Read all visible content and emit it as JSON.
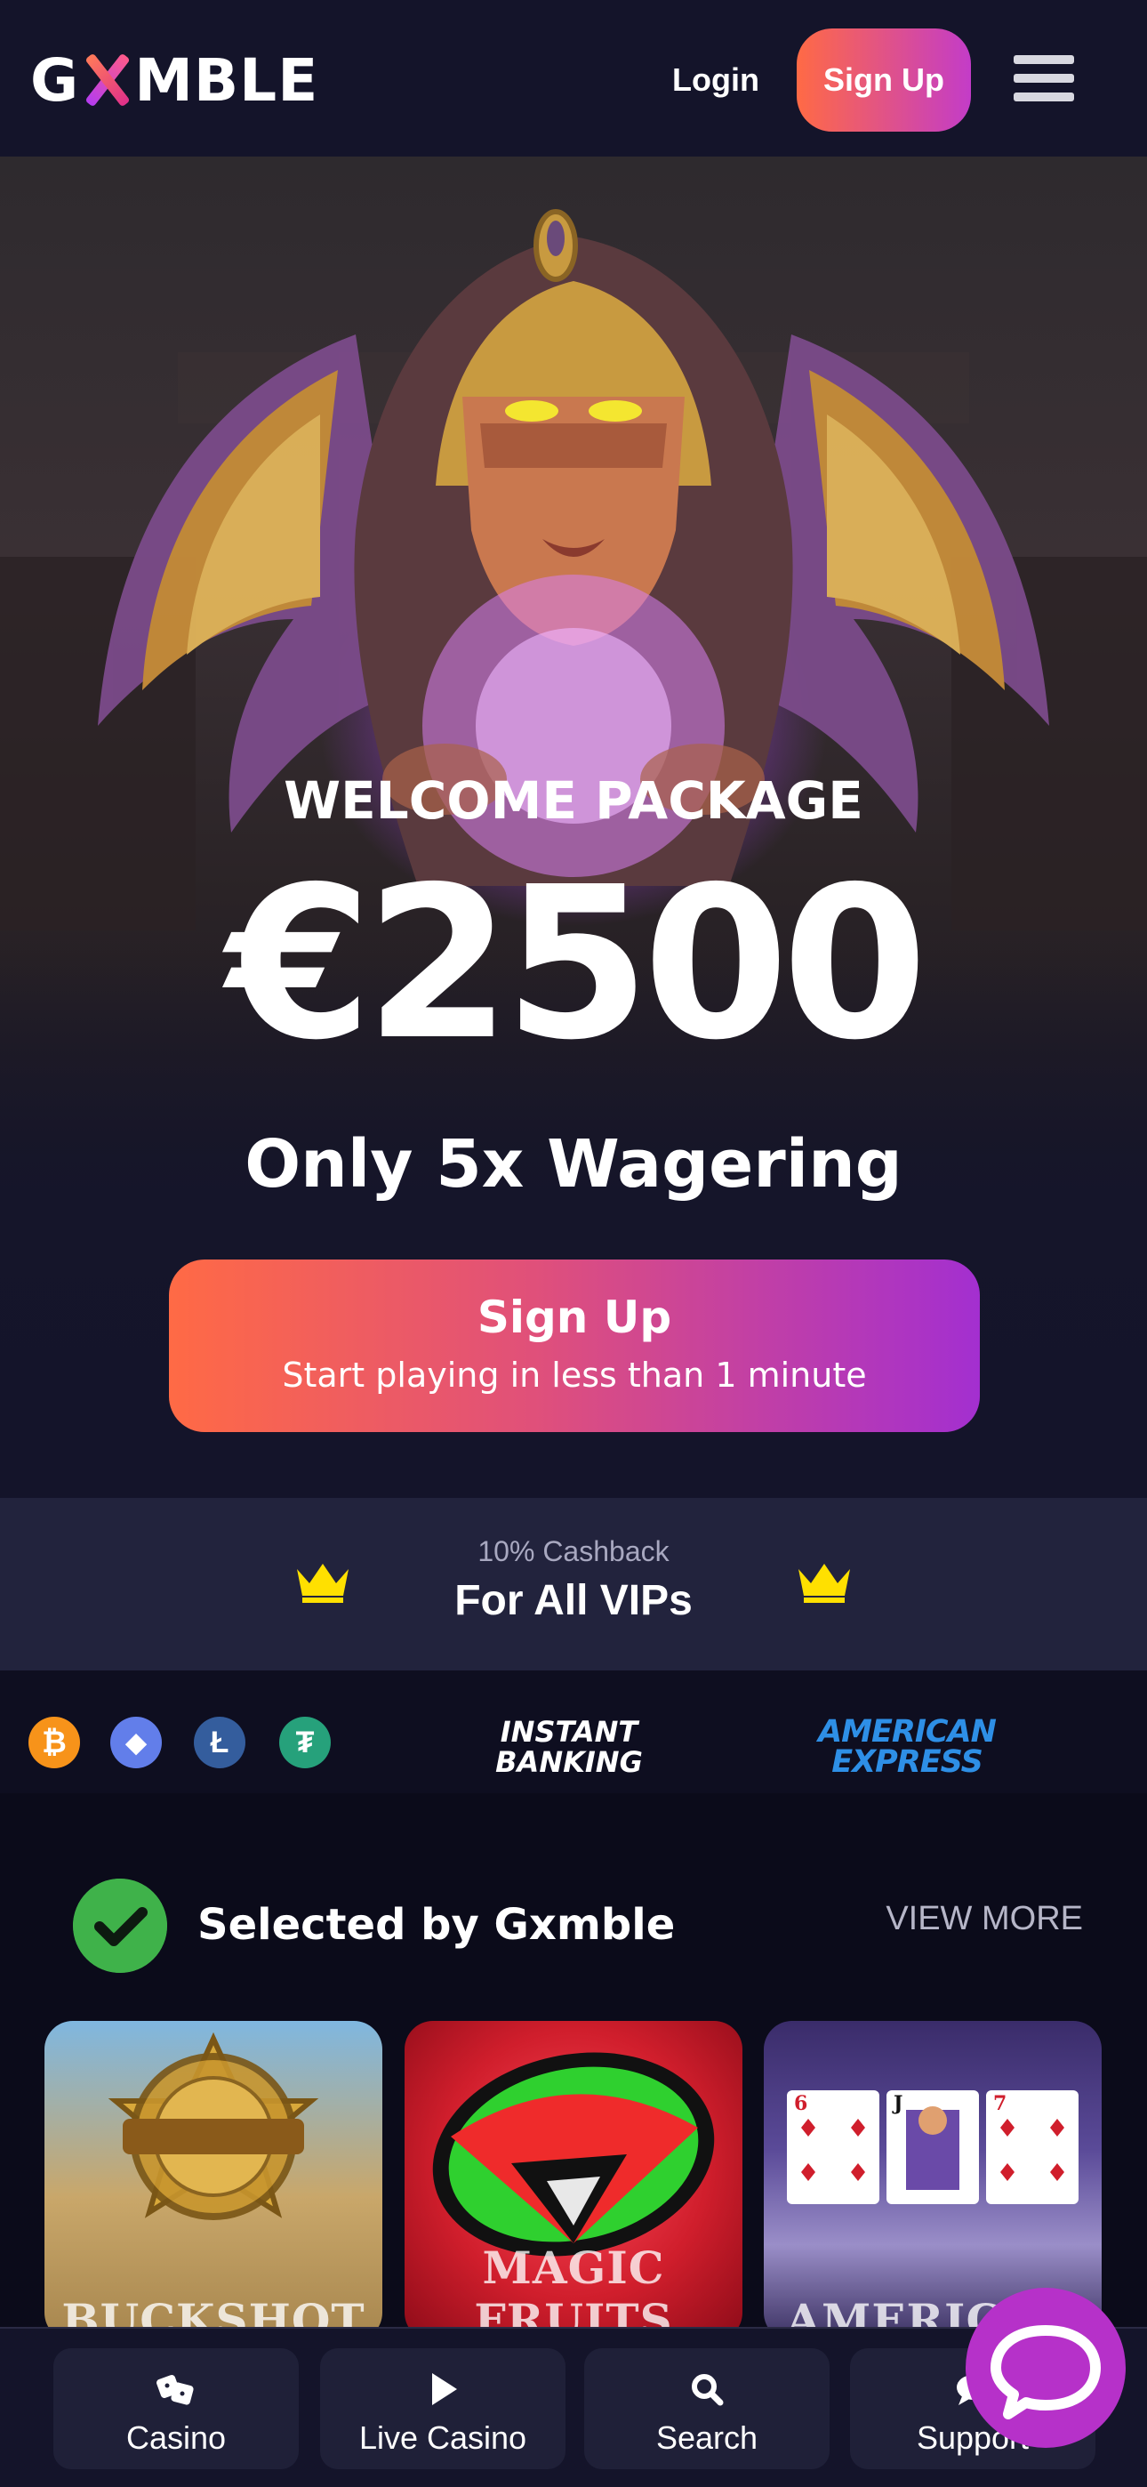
{
  "header": {
    "logo_text_left": "G",
    "logo_text_right": "MBLE",
    "login_label": "Login",
    "signup_label": "Sign Up"
  },
  "hero": {
    "welcome_title": "WELCOME PACKAGE",
    "amount": "€2500",
    "wagering": "Only 5x Wagering",
    "cta_title": "Sign Up",
    "cta_subtitle": "Start playing in less than 1 minute"
  },
  "vip": {
    "small": "10% Cashback",
    "big": "For All VIPs"
  },
  "payments": {
    "coins": [
      {
        "icon": "bitcoin-icon",
        "glyph": "₿",
        "color": "#f7931a"
      },
      {
        "icon": "ethereum-icon",
        "glyph": "◆",
        "color": "#627eea"
      },
      {
        "icon": "litecoin-icon",
        "glyph": "Ł",
        "color": "#345d9d"
      },
      {
        "icon": "tether-icon",
        "glyph": "₮",
        "color": "#26a17b"
      }
    ],
    "instant_line1": "INSTANT",
    "instant_line2": "BANKING",
    "amex_line1": "AMERICAN",
    "amex_line2": "EXPRESS"
  },
  "selected": {
    "title": "Selected by Gxmble",
    "view_more": "VIEW MORE",
    "tiles": [
      {
        "caption": "BUCKSHOT"
      },
      {
        "caption": "MAGIC FRUITS"
      },
      {
        "caption": "AMERICAN"
      }
    ]
  },
  "bottom_nav": {
    "items": [
      {
        "label": "Casino",
        "icon": "dice-icon"
      },
      {
        "label": "Live Casino",
        "icon": "play-icon"
      },
      {
        "label": "Search",
        "icon": "search-icon"
      },
      {
        "label": "Support",
        "icon": "chat-icon"
      }
    ]
  },
  "colors": {
    "accent_start": "#ff6a45",
    "accent_end": "#a32fd0",
    "crown": "#ffe000",
    "check": "#3fb24a",
    "amex": "#2e8fe6"
  }
}
